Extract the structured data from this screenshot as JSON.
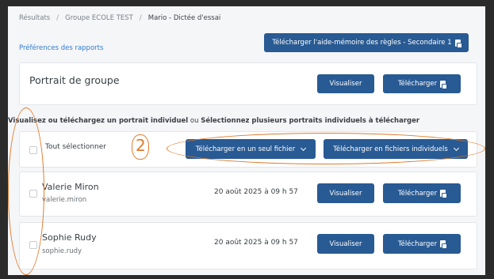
{
  "breadcrumb": {
    "items": [
      "Résultats",
      "Groupe ECOLE TEST",
      "Mario - Dictée d'essai"
    ],
    "separator": "/"
  },
  "preferences_link": "Préférences des rapports",
  "rules_button": "Télécharger l'aide-mémoire des règles - Secondaire 1",
  "group_card": {
    "title": "Portrait de groupe",
    "view_label": "Visualiser",
    "download_label": "Télécharger"
  },
  "instructions": {
    "part1": "Visualisez ou téléchargez un portrait individuel",
    "part2": " ou ",
    "part3": "Sélectionnez plusieurs portraits individuels à télécharger"
  },
  "select_all": {
    "label": "Tout sélectionner",
    "single_file_label": "Télécharger en un seul fichier",
    "individual_files_label": "Télécharger en fichiers individuels"
  },
  "students": [
    {
      "name": "Valerie Miron",
      "username": "valerie.miron",
      "date": "20 août 2025 à 09 h 57",
      "view_label": "Visualiser",
      "download_label": "Télécharger"
    },
    {
      "name": "Sophie Rudy",
      "username": "sophie.rudy",
      "date": "20 août 2025 à 09 h 57",
      "view_label": "Visualiser",
      "download_label": "Télécharger"
    }
  ],
  "annotation": {
    "number": "2",
    "color": "#e07b2a"
  },
  "colors": {
    "primary": "#285a93",
    "link": "#2f7bd0"
  }
}
